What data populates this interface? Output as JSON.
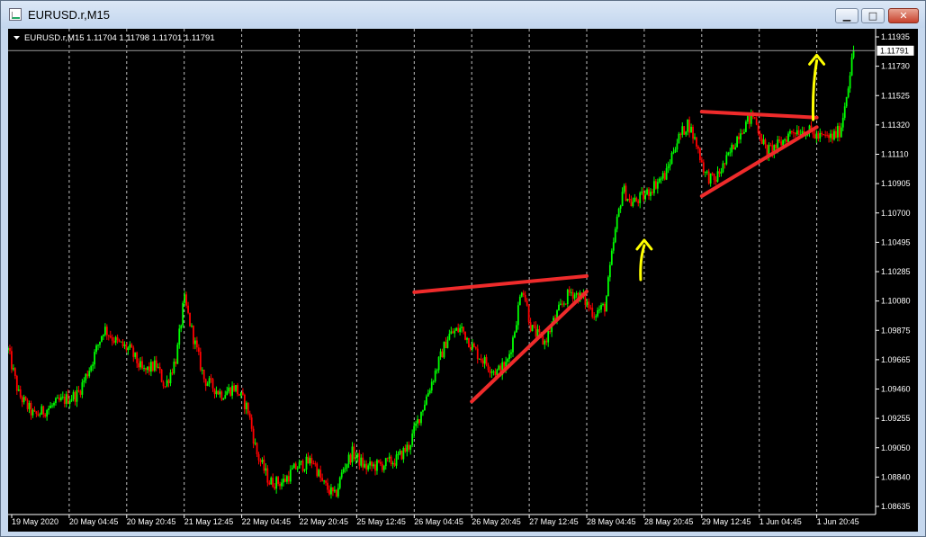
{
  "window": {
    "title": "EURUSD.r,M15",
    "buttons": {
      "minimize": "▁",
      "maximize": "□",
      "close": "✕"
    }
  },
  "header": {
    "text": "EURUSD.r,M15  1.11704 1.11798 1.11701 1.11791"
  },
  "colors": {
    "background": "#000000",
    "bull": "#00ff00",
    "bear": "#ff0000",
    "grid": "#ffffff",
    "trendline": "#ef2b2b",
    "arrow": "#ffff00",
    "axis_text": "#ffffff"
  },
  "chart_data": {
    "type": "candlestick",
    "symbol": "EURUSD.r",
    "timeframe": "M15",
    "ohlc_header": {
      "open": 1.11704,
      "high": 1.11798,
      "low": 1.11701,
      "close": 1.11791
    },
    "current_price": "1.11791",
    "ylim": [
      1.0863,
      1.1194
    ],
    "y_ticks": [
      "1.11935",
      "1.11730",
      "1.11525",
      "1.11320",
      "1.11110",
      "1.10905",
      "1.10700",
      "1.10495",
      "1.10285",
      "1.10080",
      "1.09875",
      "1.09665",
      "1.09460",
      "1.09255",
      "1.09050",
      "1.08840",
      "1.08635"
    ],
    "x_ticks": [
      "19 May 2020",
      "20 May 04:45",
      "20 May 20:45",
      "21 May 12:45",
      "22 May 04:45",
      "22 May 20:45",
      "25 May 12:45",
      "26 May 04:45",
      "26 May 20:45",
      "27 May 12:45",
      "28 May 04:45",
      "28 May 20:45",
      "29 May 12:45",
      "1 Jun 04:45",
      "1 Jun 20:45"
    ],
    "price_path": [
      [
        0,
        1.0975
      ],
      [
        0.012,
        1.0945
      ],
      [
        0.03,
        1.093
      ],
      [
        0.045,
        1.0935
      ],
      [
        0.06,
        1.094
      ],
      [
        0.08,
        1.0945
      ],
      [
        0.095,
        1.0965
      ],
      [
        0.11,
        1.099
      ],
      [
        0.125,
        1.098
      ],
      [
        0.14,
        1.0975
      ],
      [
        0.155,
        1.096
      ],
      [
        0.17,
        1.0965
      ],
      [
        0.18,
        1.095
      ],
      [
        0.193,
        1.097
      ],
      [
        0.202,
        1.101
      ],
      [
        0.212,
        1.0985
      ],
      [
        0.225,
        1.0955
      ],
      [
        0.245,
        1.0945
      ],
      [
        0.26,
        1.095
      ],
      [
        0.275,
        1.0935
      ],
      [
        0.285,
        1.0905
      ],
      [
        0.3,
        1.0885
      ],
      [
        0.315,
        1.0885
      ],
      [
        0.33,
        1.0895
      ],
      [
        0.35,
        1.09
      ],
      [
        0.36,
        1.0885
      ],
      [
        0.375,
        1.0875
      ],
      [
        0.385,
        1.0895
      ],
      [
        0.395,
        1.0905
      ],
      [
        0.41,
        1.0895
      ],
      [
        0.43,
        1.0897
      ],
      [
        0.445,
        1.09
      ],
      [
        0.46,
        1.091
      ],
      [
        0.475,
        1.0935
      ],
      [
        0.49,
        1.096
      ],
      [
        0.505,
        1.0985
      ],
      [
        0.52,
        1.099
      ],
      [
        0.535,
        1.0975
      ],
      [
        0.55,
        1.0965
      ],
      [
        0.56,
        1.096
      ],
      [
        0.572,
        1.0965
      ],
      [
        0.58,
        1.0985
      ],
      [
        0.59,
        1.102
      ],
      [
        0.6,
        1.099
      ],
      [
        0.615,
        1.098
      ],
      [
        0.63,
        1.1
      ],
      [
        0.645,
        1.1015
      ],
      [
        0.66,
        1.101
      ],
      [
        0.672,
        1.1
      ],
      [
        0.685,
        1.1005
      ],
      [
        0.695,
        1.105
      ],
      [
        0.705,
        1.1085
      ],
      [
        0.715,
        1.1075
      ],
      [
        0.73,
        1.108
      ],
      [
        0.745,
        1.109
      ],
      [
        0.755,
        1.1095
      ],
      [
        0.765,
        1.1115
      ],
      [
        0.78,
        1.113
      ],
      [
        0.79,
        1.1115
      ],
      [
        0.8,
        1.1095
      ],
      [
        0.81,
        1.109
      ],
      [
        0.825,
        1.1105
      ],
      [
        0.84,
        1.1125
      ],
      [
        0.855,
        1.1135
      ],
      [
        0.87,
        1.111
      ],
      [
        0.885,
        1.1115
      ],
      [
        0.9,
        1.1125
      ],
      [
        0.915,
        1.1125
      ],
      [
        0.93,
        1.112
      ],
      [
        0.945,
        1.112
      ],
      [
        0.955,
        1.1125
      ],
      [
        0.962,
        1.115
      ],
      [
        0.97,
        1.1179
      ]
    ],
    "annotations": {
      "trendlines": [
        {
          "from": [
            "26 May 04:45",
            1.10145
          ],
          "to": [
            "28 May 04:45",
            1.10255
          ]
        },
        {
          "from": [
            "26 May 20:45",
            1.094
          ],
          "to": [
            "28 May 04:45",
            1.1015
          ]
        },
        {
          "from": [
            "29 May 12:45",
            1.11375
          ],
          "to": [
            "1 Jun 20:45",
            1.11335
          ]
        },
        {
          "from": [
            "29 May 12:45",
            1.108
          ],
          "to": [
            "1 Jun 20:45",
            1.1127
          ]
        }
      ],
      "arrows": [
        {
          "at": "28 May 20:45",
          "from": 1.1023,
          "to": 1.105
        },
        {
          "at": "1 Jun 20:45",
          "from": 1.1132,
          "to": 1.1176
        }
      ]
    }
  }
}
